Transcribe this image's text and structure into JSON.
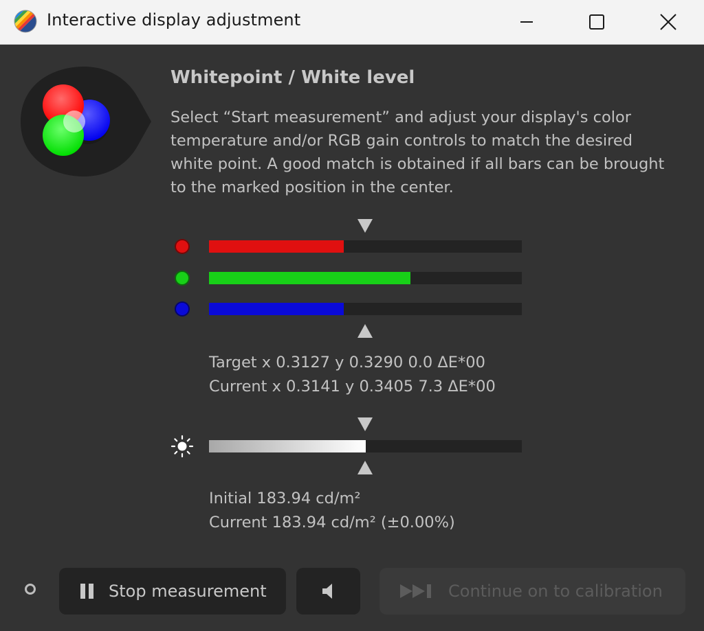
{
  "window": {
    "title": "Interactive display adjustment",
    "controls": {
      "minimize_icon": "minimize-icon",
      "maximize_icon": "maximize-icon",
      "close_icon": "close-icon"
    }
  },
  "header": {
    "title": "Whitepoint / White level",
    "description": "Select “Start measurement” and adjust your display's color temperature and/or RGB gain controls to match the desired white point. A good match is obtained if all bars can be brought to the marked position in the center."
  },
  "rgb_bars": {
    "red": {
      "color": "#e01010",
      "level": 0.43
    },
    "green": {
      "color": "#18d018",
      "level": 0.645
    },
    "blue": {
      "color": "#0a0ad8",
      "level": 0.43
    }
  },
  "whitepoint": {
    "target": "Target x 0.3127 y 0.3290 0.0 ΔE*00",
    "current": "Current x 0.3141 y 0.3405 7.3 ΔE*00"
  },
  "luminance": {
    "icon": "sun-icon",
    "level": 0.5,
    "initial": "Initial 183.94 cd/m²",
    "current": "Current 183.94 cd/m² (±0.00%)"
  },
  "footer": {
    "stop_button": "Stop measurement",
    "stop_icon": "pause-icon",
    "sound_icon": "speaker-icon",
    "continue_button": "Continue on to calibration",
    "continue_icon": "skip-forward-icon"
  }
}
